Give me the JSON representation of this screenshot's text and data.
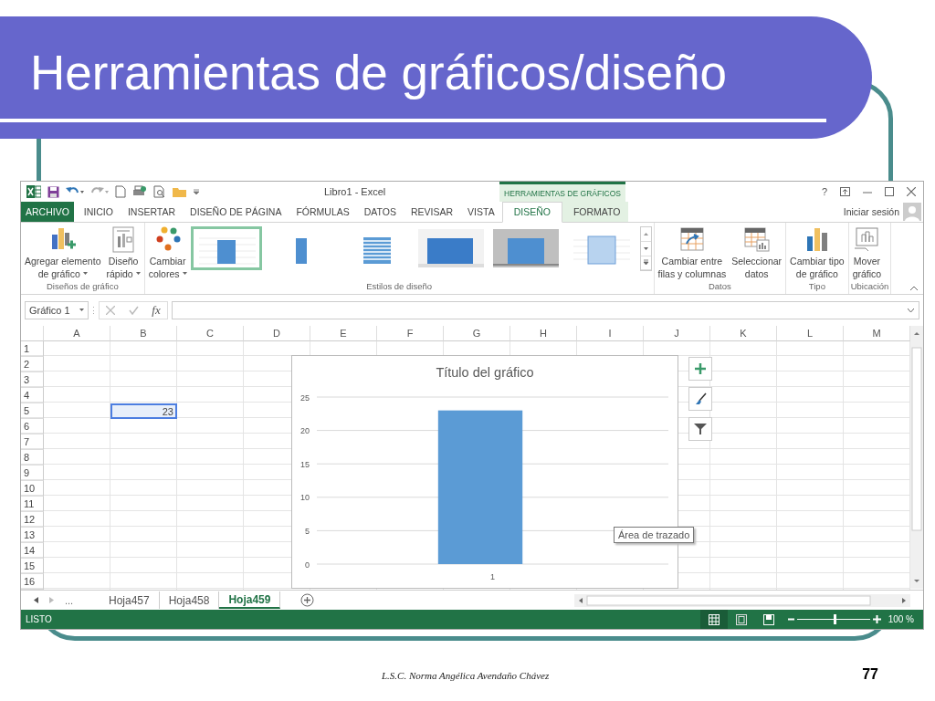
{
  "slide": {
    "title": "Herramientas de gráficos/diseño",
    "footer": "L.S.C. Norma Angélica Avendaño Chávez",
    "page_number": "77"
  },
  "window": {
    "title": "Libro1 - Excel",
    "context_group": "HERRAMIENTAS DE GRÁFICOS",
    "help": "?",
    "sign_in": "Iniciar sesión"
  },
  "tabs": [
    {
      "label": "ARCHIVO",
      "kind": "file",
      "selected": false
    },
    {
      "label": "INICIO",
      "kind": "normal",
      "selected": false
    },
    {
      "label": "INSERTAR",
      "kind": "normal",
      "selected": false
    },
    {
      "label": "DISEÑO DE PÁGINA",
      "kind": "normal",
      "selected": false
    },
    {
      "label": "FÓRMULAS",
      "kind": "normal",
      "selected": false
    },
    {
      "label": "DATOS",
      "kind": "normal",
      "selected": false
    },
    {
      "label": "REVISAR",
      "kind": "normal",
      "selected": false
    },
    {
      "label": "VISTA",
      "kind": "normal",
      "selected": false
    },
    {
      "label": "DISEÑO",
      "kind": "context",
      "selected": true
    },
    {
      "label": "FORMATO",
      "kind": "context",
      "selected": false
    }
  ],
  "ribbon_groups": [
    {
      "label": "Diseños de gráfico",
      "commands": [
        {
          "kind": "add_element",
          "lines": [
            "Agregar elemento",
            "de gráfico"
          ],
          "dropdown": true
        },
        {
          "kind": "quick_layout",
          "lines": [
            "Diseño",
            "rápido"
          ],
          "dropdown": true
        }
      ]
    },
    {
      "label": "Estilos de diseño",
      "commands": [
        {
          "kind": "colors",
          "lines": [
            "Cambiar",
            "colores"
          ],
          "dropdown": true
        }
      ],
      "gallery": [
        {
          "kind": "plain",
          "selected": true
        },
        {
          "kind": "narrow",
          "selected": false
        },
        {
          "kind": "striped",
          "selected": false
        },
        {
          "kind": "wide",
          "selected": false
        },
        {
          "kind": "shadow",
          "selected": false
        },
        {
          "kind": "pale",
          "selected": false
        }
      ]
    },
    {
      "label": "Datos",
      "commands": [
        {
          "kind": "switch",
          "lines": [
            "Cambiar entre",
            "filas y columnas"
          ],
          "dropdown": false
        },
        {
          "kind": "select_data",
          "lines": [
            "Seleccionar",
            "datos"
          ],
          "dropdown": false
        }
      ]
    },
    {
      "label": "Tipo",
      "commands": [
        {
          "kind": "chart_type",
          "lines": [
            "Cambiar tipo",
            "de gráfico"
          ],
          "dropdown": false
        }
      ]
    },
    {
      "label": "Ubicación",
      "commands": [
        {
          "kind": "move_chart",
          "lines": [
            "Mover",
            "gráfico"
          ],
          "dropdown": false
        }
      ]
    }
  ],
  "formula_bar": {
    "name_box": "Gráfico 1",
    "function_label": "fx"
  },
  "grid": {
    "columns": [
      "A",
      "B",
      "C",
      "D",
      "E",
      "F",
      "G",
      "H",
      "I",
      "J",
      "K",
      "L",
      "M"
    ],
    "rows": [
      {
        "header": "1"
      },
      {
        "header": "2"
      },
      {
        "header": "3"
      },
      {
        "header": "4"
      },
      {
        "header": "5",
        "cells": [
          null,
          {
            "value": "23",
            "selected": true
          }
        ]
      },
      {
        "header": "6"
      },
      {
        "header": "7"
      },
      {
        "header": "8"
      },
      {
        "header": "9"
      },
      {
        "header": "10"
      },
      {
        "header": "11"
      },
      {
        "header": "12"
      },
      {
        "header": "13"
      },
      {
        "header": "14"
      },
      {
        "header": "15"
      },
      {
        "header": "16"
      }
    ]
  },
  "chart": {
    "tooltip": "Área de trazado",
    "chart_data": {
      "type": "bar",
      "title": "Título del gráfico",
      "categories": [
        "1"
      ],
      "series": [
        {
          "color": "#5b9bd5",
          "values": [
            23
          ]
        }
      ],
      "ylim": [
        0,
        25
      ],
      "grid": true,
      "yticks": [
        0,
        5,
        10,
        15,
        20,
        25
      ]
    }
  },
  "sheet_tabs": {
    "overflow": "...",
    "tabs": [
      {
        "label": "Hoja457",
        "selected": false
      },
      {
        "label": "Hoja458",
        "selected": false
      },
      {
        "label": "Hoja459",
        "selected": true
      }
    ]
  },
  "status_bar": {
    "status": "LISTO",
    "views": [
      {
        "kind": "normal",
        "selected": true
      },
      {
        "kind": "page_layout",
        "selected": false
      },
      {
        "kind": "page_break",
        "selected": false
      }
    ],
    "zoom_slider": {
      "level": 0.52
    },
    "zoom": "100 %"
  }
}
